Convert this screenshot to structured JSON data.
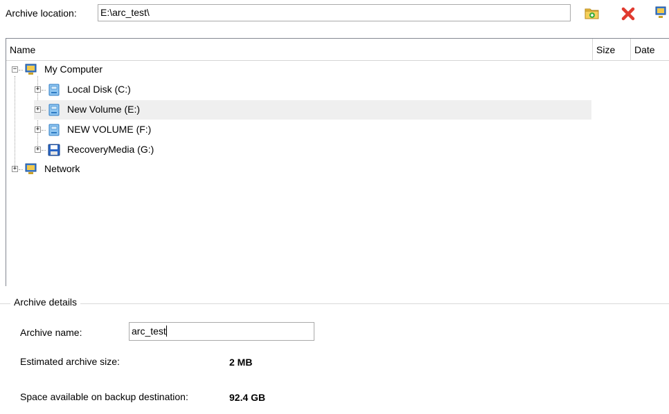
{
  "location": {
    "label": "Archive location:",
    "value": "E:\\arc_test\\"
  },
  "toolbar": {
    "new_folder_icon": "new-folder-icon",
    "delete_icon": "delete-icon",
    "network_icon": "network-icon"
  },
  "columns": {
    "name": "Name",
    "size": "Size",
    "date": "Date"
  },
  "tree": {
    "my_computer": "My Computer",
    "drives": [
      {
        "label": "Local Disk (C:)"
      },
      {
        "label": "New Volume (E:)"
      },
      {
        "label": "NEW VOLUME (F:)"
      },
      {
        "label": "RecoveryMedia (G:)"
      }
    ],
    "network": "Network"
  },
  "details": {
    "legend": "Archive details",
    "archive_name_label": "Archive name:",
    "archive_name_value": "arc_test",
    "estimated_label": "Estimated archive size:",
    "estimated_value": "2 MB",
    "space_label": "Space available on backup destination:",
    "space_value": "92.4 GB"
  },
  "colors": {
    "selection": "#efefef",
    "delete_red": "#e03a2f"
  }
}
